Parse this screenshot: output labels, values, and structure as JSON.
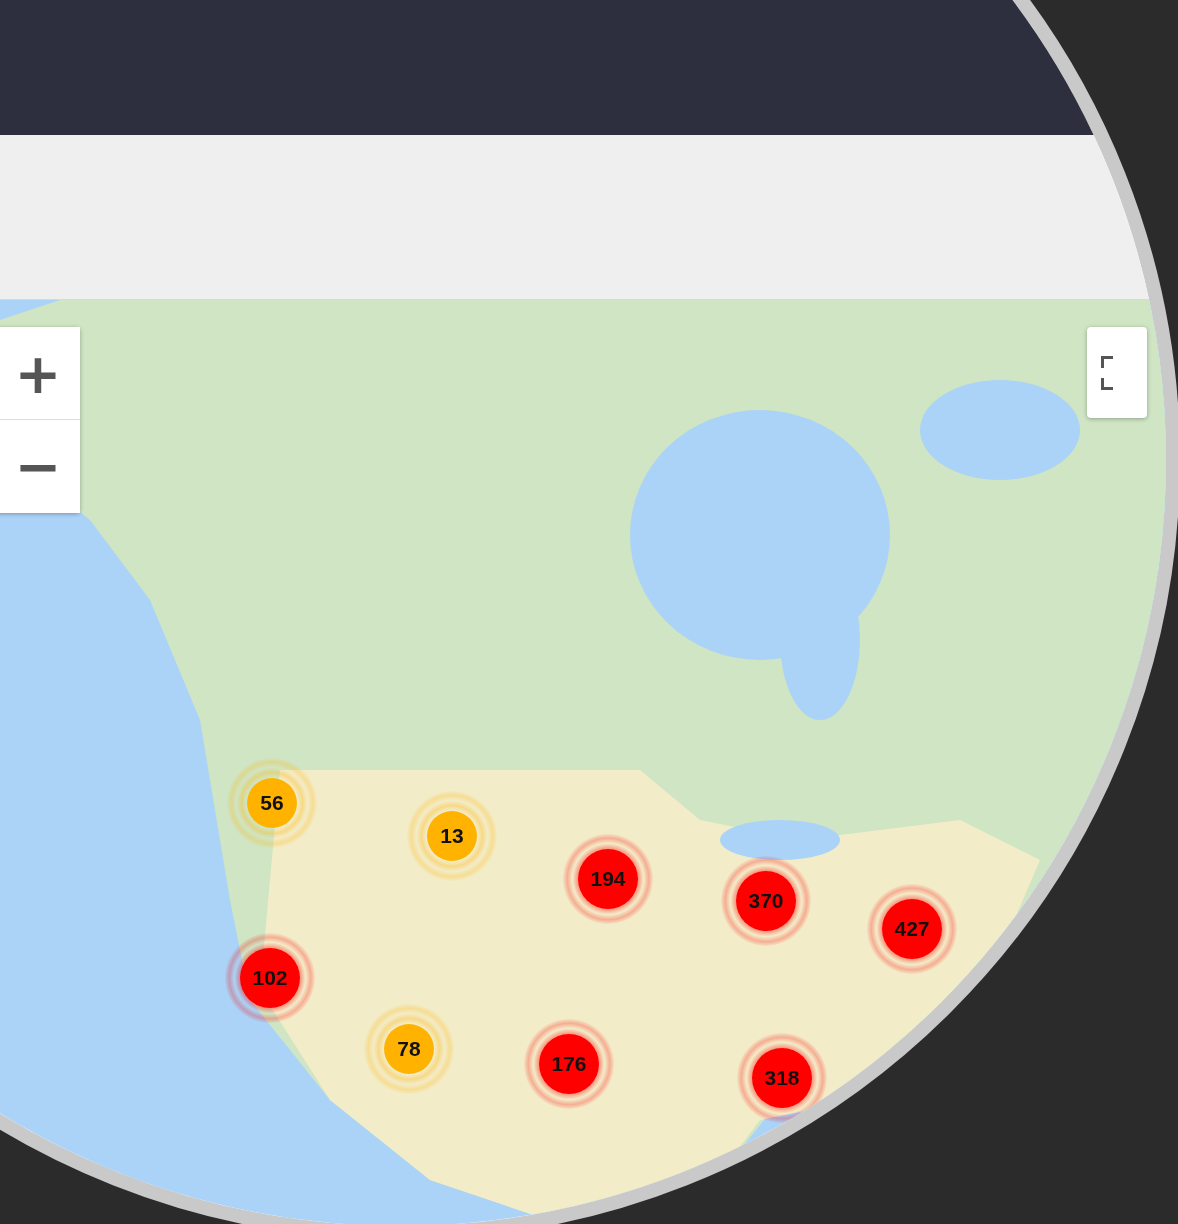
{
  "map": {
    "zoom_controls": [
      {
        "label": "+"
      },
      {
        "label": "−"
      }
    ],
    "clusters": [
      {
        "count": "56",
        "color": "#ffb300"
      },
      {
        "count": "13",
        "color": "#ffb300"
      },
      {
        "count": "194",
        "color": "#ff0000"
      },
      {
        "count": "370",
        "color": "#ff0000"
      },
      {
        "count": "427",
        "color": "#ff0000"
      },
      {
        "count": "102",
        "color": "#ff0000"
      },
      {
        "count": "78",
        "color": "#ffb300"
      },
      {
        "count": "176",
        "color": "#ff0000"
      },
      {
        "count": "318",
        "color": "#ff0000"
      }
    ]
  }
}
